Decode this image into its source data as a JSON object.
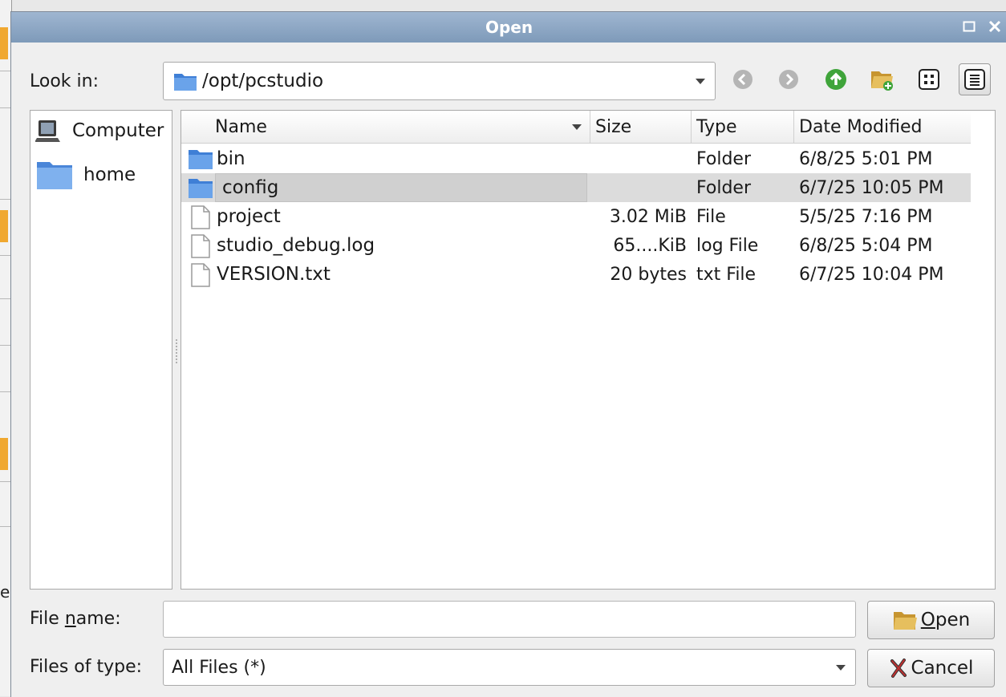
{
  "dialog": {
    "title": "Open",
    "maximize_icon": "square-icon",
    "close_icon": "x-icon"
  },
  "look_in": {
    "label": "Look in:",
    "path": "/opt/pcstudio"
  },
  "toolbar": {
    "buttons": [
      "back-icon",
      "forward-icon",
      "parent-directory-icon",
      "new-folder-icon",
      "list-view-icon",
      "detail-view-icon"
    ]
  },
  "sidebar": {
    "items": [
      {
        "label": "Computer",
        "icon": "computer-icon"
      },
      {
        "label": "home",
        "icon": "folder-icon"
      }
    ]
  },
  "file_list": {
    "headers": [
      "Name",
      "Size",
      "Type",
      "Date Modified"
    ],
    "rows": [
      {
        "name": "bin",
        "size": "",
        "type": "Folder",
        "date": "6/8/25 5:01 PM",
        "icon": "folder-icon"
      },
      {
        "name": "config",
        "size": "",
        "type": "Folder",
        "date": "6/7/25 10:05 PM",
        "icon": "folder-icon",
        "selected": true
      },
      {
        "name": "project",
        "size": "3.02 MiB",
        "type": "File",
        "date": "5/5/25 7:16 PM",
        "icon": "file-icon"
      },
      {
        "name": "studio_debug.log",
        "size": "65....KiB",
        "type": "log File",
        "date": "6/8/25 5:04 PM",
        "icon": "file-icon"
      },
      {
        "name": "VERSION.txt",
        "size": "20 bytes",
        "type": "txt File",
        "date": "6/7/25 10:04 PM",
        "icon": "file-icon"
      }
    ]
  },
  "file_name": {
    "label_pre": "File ",
    "label_mnemonic": "n",
    "label_post": "ame:",
    "value": ""
  },
  "file_type": {
    "label": "Files of type:",
    "value": "All Files (*)"
  },
  "buttons": {
    "open_mnemonic": "O",
    "open_rest": "pen",
    "cancel": "Cancel"
  },
  "background": {
    "fragment": "er"
  },
  "colors": {
    "titlebar": "#8aa4c2",
    "folder": "#4a86d8",
    "selection": "#dcdcdc",
    "accent_orange": "#f0a830"
  }
}
